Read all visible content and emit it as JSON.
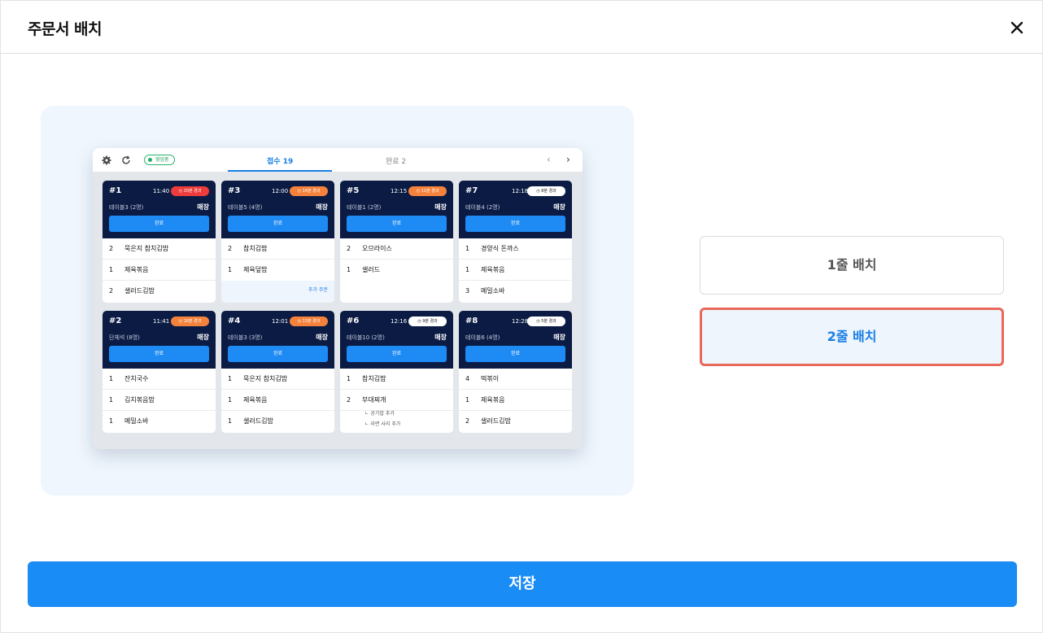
{
  "header": {
    "title": "주문서 배치"
  },
  "preview": {
    "status": "영업중",
    "tabs": [
      {
        "label": "접수 19"
      },
      {
        "label": "완료 2"
      }
    ],
    "tickets": [
      {
        "number": "#1",
        "time": "11:40",
        "elapsed": "20분 경과",
        "badge_color": "red",
        "table": "테이블3 (2명)",
        "type": "매장",
        "button": "완료",
        "items": [
          {
            "qty": "2",
            "name": "묵은지 참치김밥"
          },
          {
            "qty": "1",
            "name": "제육볶음"
          },
          {
            "qty": "2",
            "name": "샐러드김밥"
          }
        ]
      },
      {
        "number": "#3",
        "time": "12:00",
        "elapsed": "14분 경과",
        "badge_color": "orange",
        "table": "테이블5 (4명)",
        "type": "매장",
        "button": "완료",
        "items": [
          {
            "qty": "2",
            "name": "참치김밥"
          },
          {
            "qty": "1",
            "name": "제육덮밥"
          }
        ],
        "extra": "추가 주문"
      },
      {
        "number": "#5",
        "time": "12:15",
        "elapsed": "11분 경과",
        "badge_color": "orange",
        "table": "테이블1 (2명)",
        "type": "매장",
        "button": "완료",
        "items": [
          {
            "qty": "2",
            "name": "오므라이스"
          },
          {
            "qty": "1",
            "name": "샐러드"
          }
        ]
      },
      {
        "number": "#7",
        "time": "12:18",
        "elapsed": "8분 경과",
        "badge_color": "white",
        "table": "테이블4 (2명)",
        "type": "매장",
        "button": "완료",
        "items": [
          {
            "qty": "1",
            "name": "경양식 돈까스"
          },
          {
            "qty": "1",
            "name": "제육볶음"
          },
          {
            "qty": "3",
            "name": "메밀소바"
          }
        ]
      },
      {
        "number": "#2",
        "time": "11:41",
        "elapsed": "16분 경과",
        "badge_color": "orange",
        "table": "단체석 (8명)",
        "type": "매장",
        "button": "완료",
        "items": [
          {
            "qty": "1",
            "name": "잔치국수"
          },
          {
            "qty": "1",
            "name": "김치볶음밥"
          },
          {
            "qty": "1",
            "name": "메밀소바"
          }
        ]
      },
      {
        "number": "#4",
        "time": "12:01",
        "elapsed": "13분 경과",
        "badge_color": "orange",
        "table": "테이블3 (3명)",
        "type": "매장",
        "button": "완료",
        "items": [
          {
            "qty": "1",
            "name": "묵은지 참치김밥"
          },
          {
            "qty": "1",
            "name": "제육볶음"
          },
          {
            "qty": "1",
            "name": "샐러드김밥"
          }
        ]
      },
      {
        "number": "#6",
        "time": "12:16",
        "elapsed": "9분 경과",
        "badge_color": "white",
        "table": "테이블10 (2명)",
        "type": "매장",
        "button": "완료",
        "items": [
          {
            "qty": "1",
            "name": "참치김밥"
          },
          {
            "qty": "2",
            "name": "부대찌개"
          }
        ],
        "sub_items": [
          "ㄴ 공기밥 추가",
          "ㄴ 라면 사리 추가"
        ]
      },
      {
        "number": "#8",
        "time": "12:28",
        "elapsed": "5분 경과",
        "badge_color": "white",
        "table": "테이블6 (4명)",
        "type": "매장",
        "button": "완료",
        "items": [
          {
            "qty": "4",
            "name": "떡볶이"
          },
          {
            "qty": "1",
            "name": "제육볶음"
          },
          {
            "qty": "2",
            "name": "샐러드김밥"
          }
        ]
      }
    ]
  },
  "options": [
    {
      "label": "1줄 배치",
      "selected": false
    },
    {
      "label": "2줄 배치",
      "selected": true
    }
  ],
  "footer": {
    "save_label": "저장"
  },
  "colors": {
    "primary": "#1a8cf5",
    "selected_border": "#e8685a",
    "ticket_header": "#0b1b44"
  }
}
